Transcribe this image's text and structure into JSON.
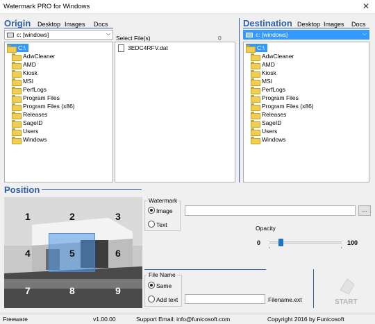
{
  "window": {
    "title": "Watermark PRO for Windows",
    "close_glyph": "✕"
  },
  "origin": {
    "title": "Origin",
    "nav": [
      "Desktop",
      "Images",
      "Docs"
    ],
    "drive": "c: [windows]",
    "tree": [
      "C:\\",
      "AdwCleaner",
      "AMD",
      "Kiosk",
      "MSI",
      "PerfLogs",
      "Program Files",
      "Program Files (x86)",
      "Releases",
      "SageID",
      "Users",
      "Windows"
    ]
  },
  "files": {
    "label": "Select File(s)",
    "count": "0",
    "items": [
      "3EDC4RFV.dat"
    ]
  },
  "destination": {
    "title": "Destination",
    "nav": [
      "Desktop",
      "Images",
      "Docs"
    ],
    "drive": "c: [windows]",
    "tree": [
      "C:\\",
      "AdwCleaner",
      "AMD",
      "Kiosk",
      "MSI",
      "PerfLogs",
      "Program Files",
      "Program Files (x86)",
      "Releases",
      "SageID",
      "Users",
      "Windows"
    ]
  },
  "position": {
    "title": "Position",
    "cells": [
      "1",
      "2",
      "3",
      "4",
      "5",
      "6",
      "7",
      "8",
      "9"
    ],
    "selected": "5"
  },
  "watermark": {
    "group": "Watermark",
    "options": [
      "Image",
      "Text"
    ],
    "selected": "Image",
    "path_value": "",
    "browse_label": "...",
    "opacity_label": "Opacity",
    "opacity_min": "0",
    "opacity_max": "100",
    "opacity_value": 15
  },
  "filename": {
    "group": "File Name",
    "options": [
      "Same",
      "Add text"
    ],
    "selected": "Same",
    "text_value": "",
    "suffix": "Filename.ext"
  },
  "start_label": "START",
  "status": {
    "license": "Freeware",
    "version": "v1.00.00",
    "support": "Support Email: info@funicosoft.com",
    "copyright": "Copyright 2016 by Funicosoft"
  },
  "colors": {
    "accent": "#2f5fa8",
    "selection": "#3399ff",
    "slider_thumb": "#1f73c7"
  }
}
